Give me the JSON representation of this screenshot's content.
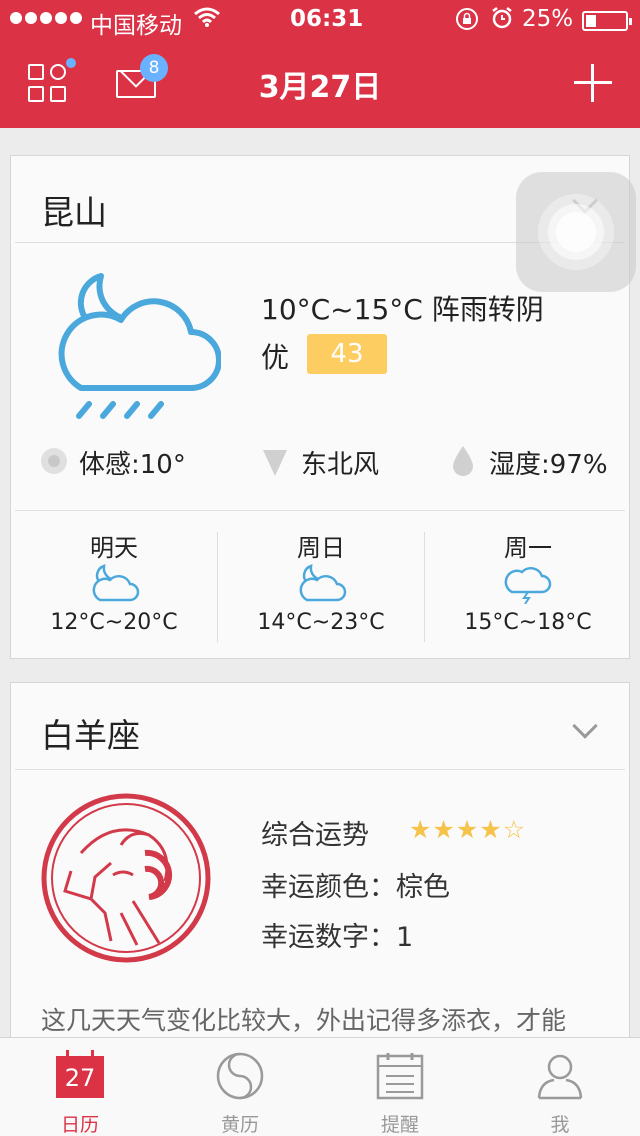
{
  "status_bar": {
    "carrier": "中国移动",
    "time": "06:31",
    "battery_text": "25%",
    "battery_level": 0.25
  },
  "nav": {
    "title": "3月27日",
    "mail_badge": "8"
  },
  "weather": {
    "city": "昆山",
    "summary": "10°C~15°C 阵雨转阴",
    "aqi_label": "优",
    "aqi_value": "43",
    "feels_like": "体感:10°",
    "wind": "东北风",
    "humidity": "湿度:97%",
    "forecast": [
      {
        "day": "明天",
        "range": "12°C~20°C",
        "icon": "cloud-moon-icon"
      },
      {
        "day": "周日",
        "range": "14°C~23°C",
        "icon": "cloud-moon-icon"
      },
      {
        "day": "周一",
        "range": "15°C~18°C",
        "icon": "thunder-cloud-icon"
      }
    ],
    "color": "#4aa8dc"
  },
  "horoscope": {
    "sign": "白羊座",
    "overall_label": "综合运势",
    "stars_filled": 4,
    "stars_total": 5,
    "color_row": "幸运颜色：棕色",
    "number_row": "幸运数字：1",
    "description": "这几天天气变化比较大，外出记得多添衣，才能",
    "emblem_color": "#d23a4a"
  },
  "tabbar": {
    "tabs": [
      {
        "label": "日历",
        "icon": "calendar-icon",
        "active": true,
        "date": "27"
      },
      {
        "label": "黄历",
        "icon": "yin-yang-icon",
        "active": false
      },
      {
        "label": "提醒",
        "icon": "notepad-icon",
        "active": false
      },
      {
        "label": "我",
        "icon": "person-icon",
        "active": false
      }
    ]
  },
  "colors": {
    "brand": "#db3246",
    "badge_blue": "#6ab2ff",
    "aqi_good": "#fdcd62"
  }
}
